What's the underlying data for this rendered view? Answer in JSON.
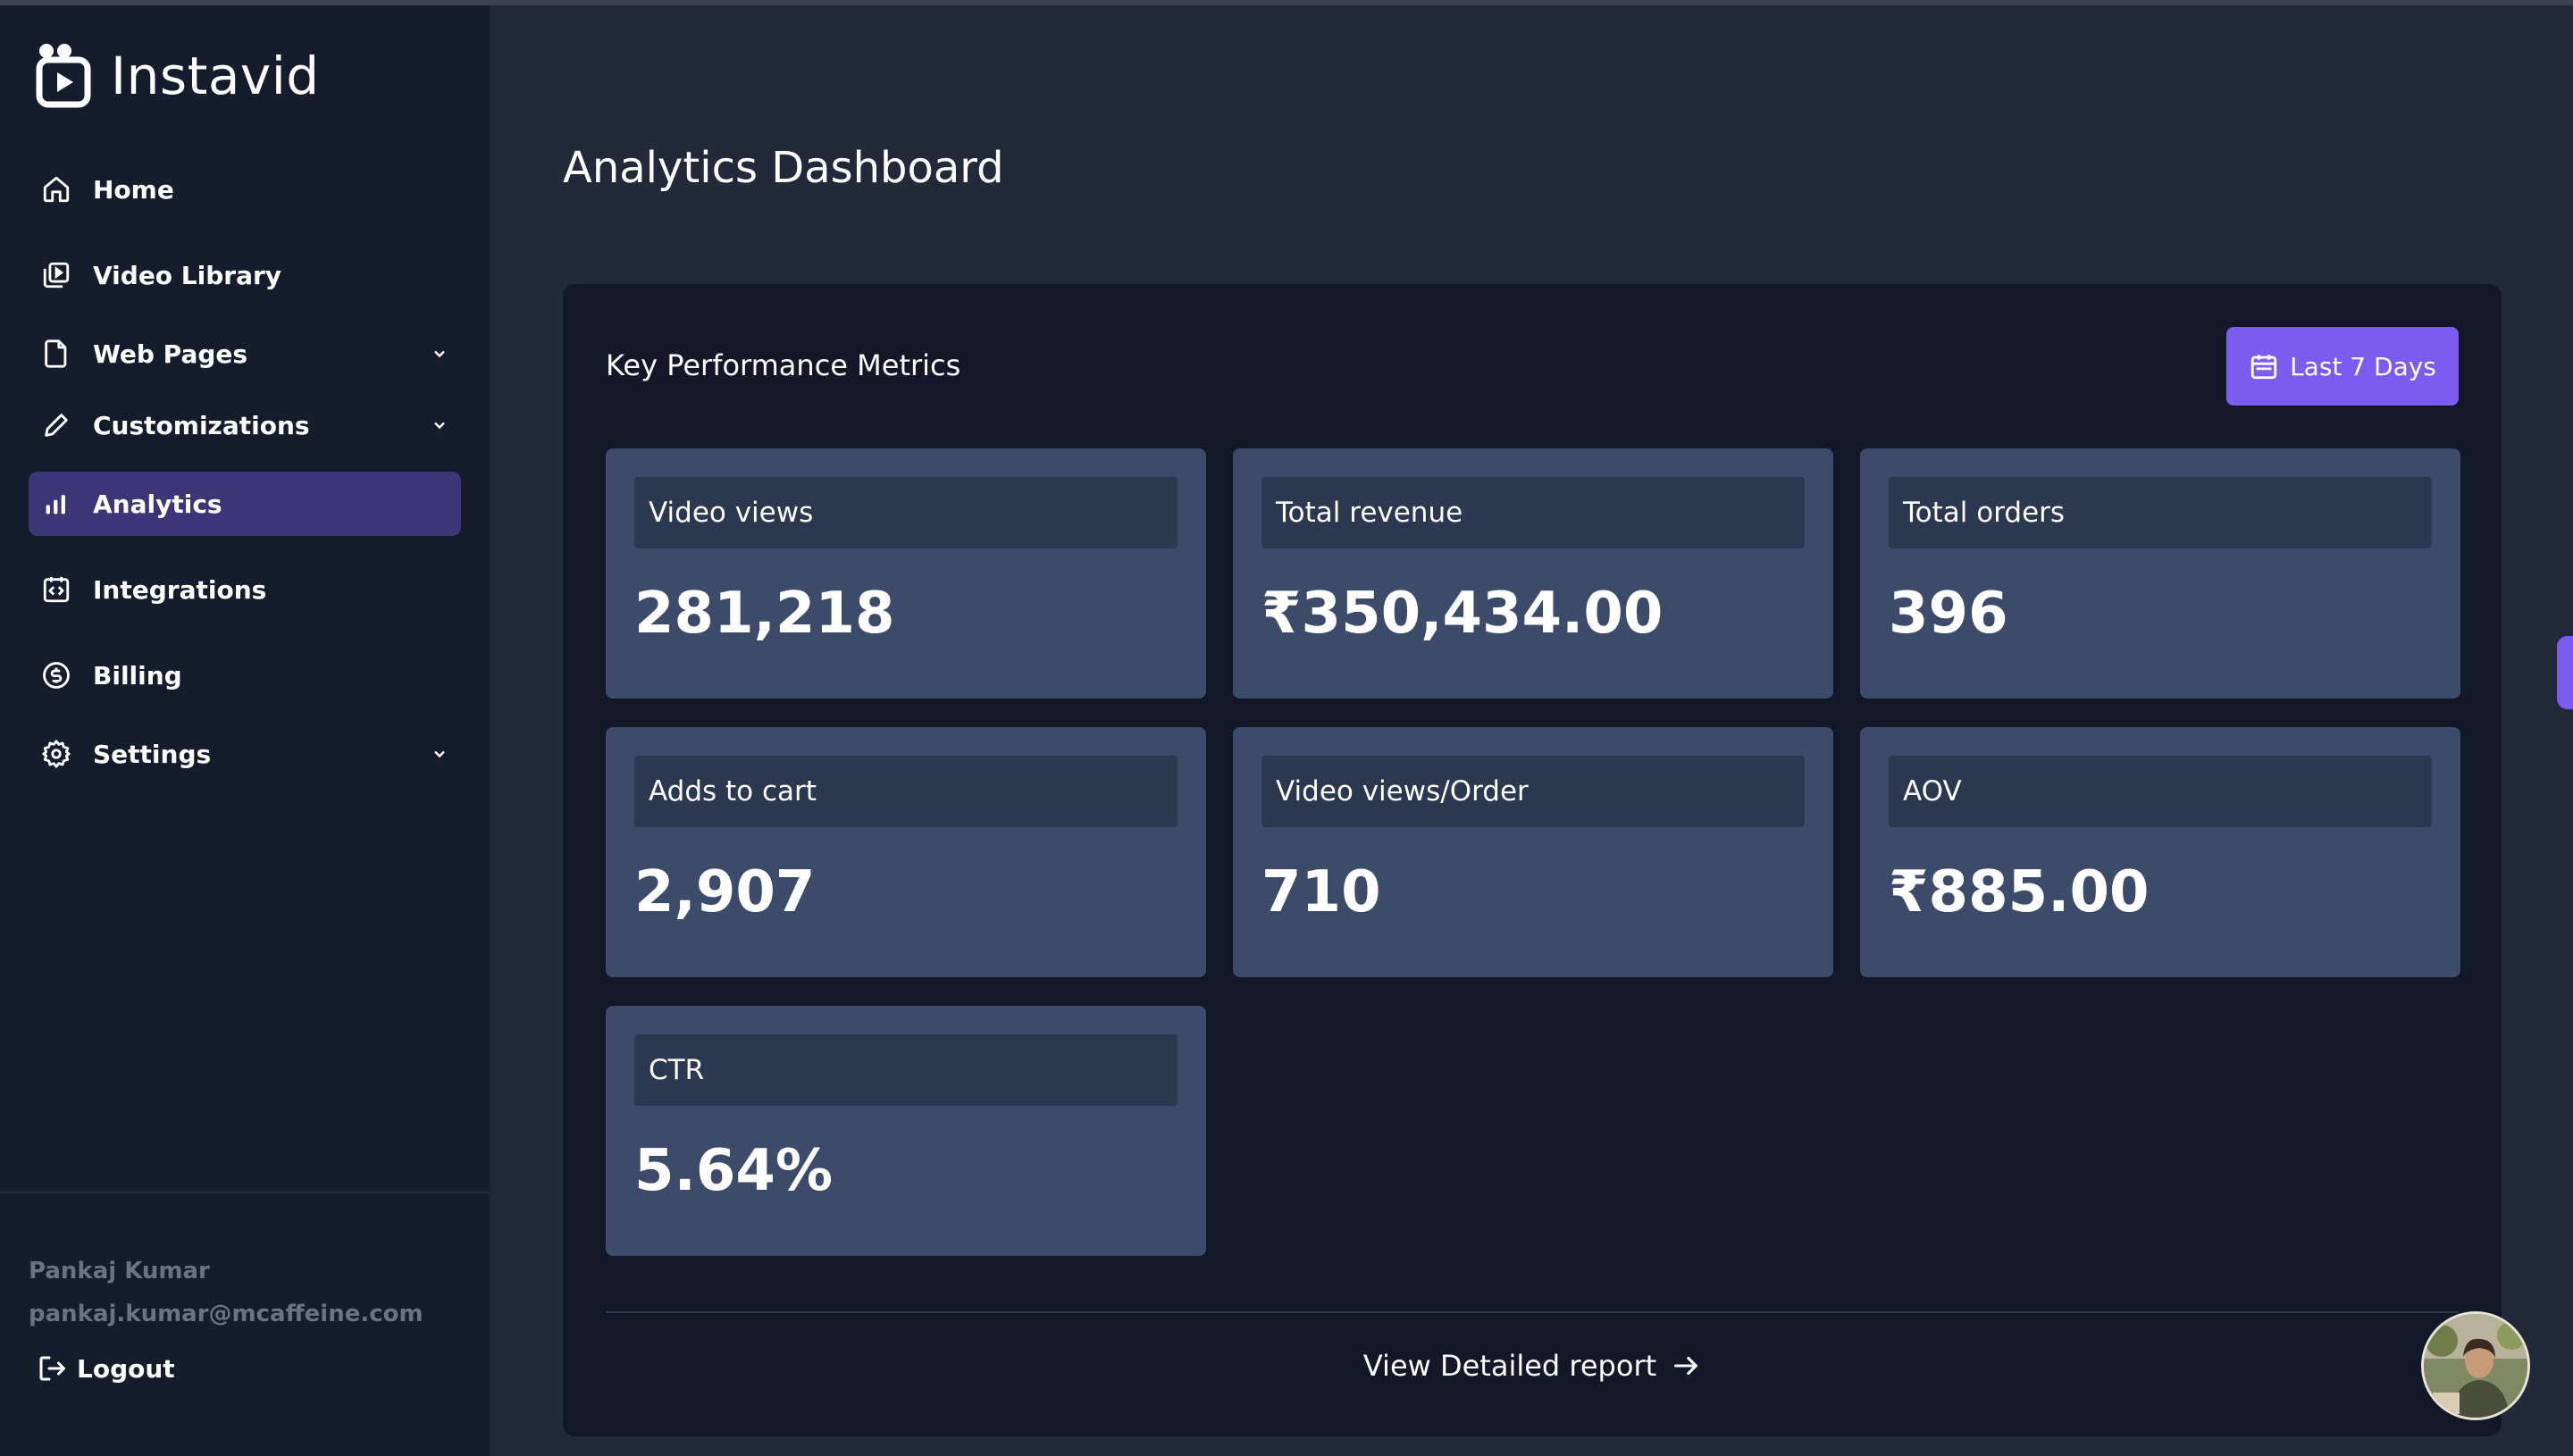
{
  "app": {
    "name": "Instavid"
  },
  "sidebar": {
    "items": [
      {
        "label": "Home",
        "icon": "home-icon",
        "expandable": false,
        "active": false
      },
      {
        "label": "Video Library",
        "icon": "video-library-icon",
        "expandable": false,
        "active": false
      },
      {
        "label": "Web Pages",
        "icon": "document-icon",
        "expandable": true,
        "active": false
      },
      {
        "label": "Customizations",
        "icon": "pencil-icon",
        "expandable": true,
        "active": false
      },
      {
        "label": "Analytics",
        "icon": "bar-chart-icon",
        "expandable": false,
        "active": true
      },
      {
        "label": "Integrations",
        "icon": "integration-icon",
        "expandable": false,
        "active": false
      },
      {
        "label": "Billing",
        "icon": "dollar-circle-icon",
        "expandable": false,
        "active": false
      },
      {
        "label": "Settings",
        "icon": "gear-icon",
        "expandable": true,
        "active": false
      }
    ],
    "user": {
      "name": "Pankaj Kumar",
      "email": "pankaj.kumar@mcaffeine.com"
    },
    "logout_label": "Logout"
  },
  "main": {
    "title": "Analytics Dashboard",
    "panel": {
      "title": "Key Performance Metrics",
      "range_button": "Last 7 Days",
      "metrics": [
        {
          "label": "Video views",
          "value": "281,218"
        },
        {
          "label": "Total revenue",
          "value": "₹350,434.00"
        },
        {
          "label": "Total orders",
          "value": "396"
        },
        {
          "label": "Adds to cart",
          "value": "2,907"
        },
        {
          "label": "Video views/Order",
          "value": "710"
        },
        {
          "label": "AOV",
          "value": "₹885.00"
        },
        {
          "label": "CTR",
          "value": "5.64%"
        }
      ],
      "report_link": "View Detailed report"
    }
  },
  "colors": {
    "accent": "#7b5cf0",
    "active_nav": "#3e3576",
    "sidebar_bg": "#151c2b",
    "page_bg": "#222a3a",
    "panel_bg": "#121827",
    "card_bg": "#3d4b6b",
    "card_label_bg": "#2c3750"
  }
}
